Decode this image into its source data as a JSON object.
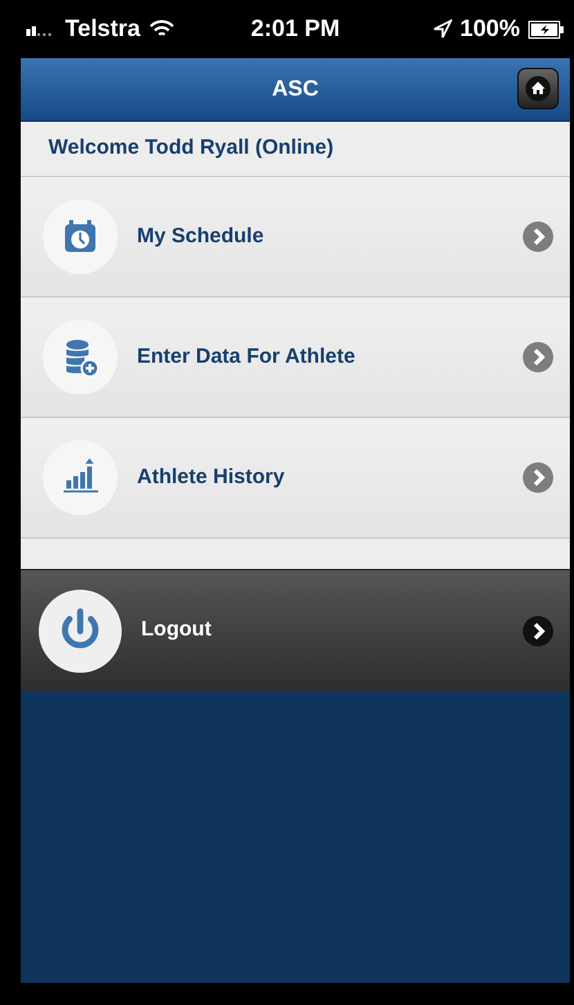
{
  "status_bar": {
    "carrier": "Telstra",
    "time": "2:01 PM",
    "battery": "100%"
  },
  "header": {
    "title": "ASC"
  },
  "welcome": "Welcome Todd Ryall (Online)",
  "menu": [
    {
      "kind": "light",
      "label": "My Schedule"
    },
    {
      "kind": "light",
      "label": "Enter Data For Athlete"
    },
    {
      "kind": "light",
      "label": "Athlete History"
    },
    {
      "kind": "dark",
      "label": "Logout"
    }
  ]
}
